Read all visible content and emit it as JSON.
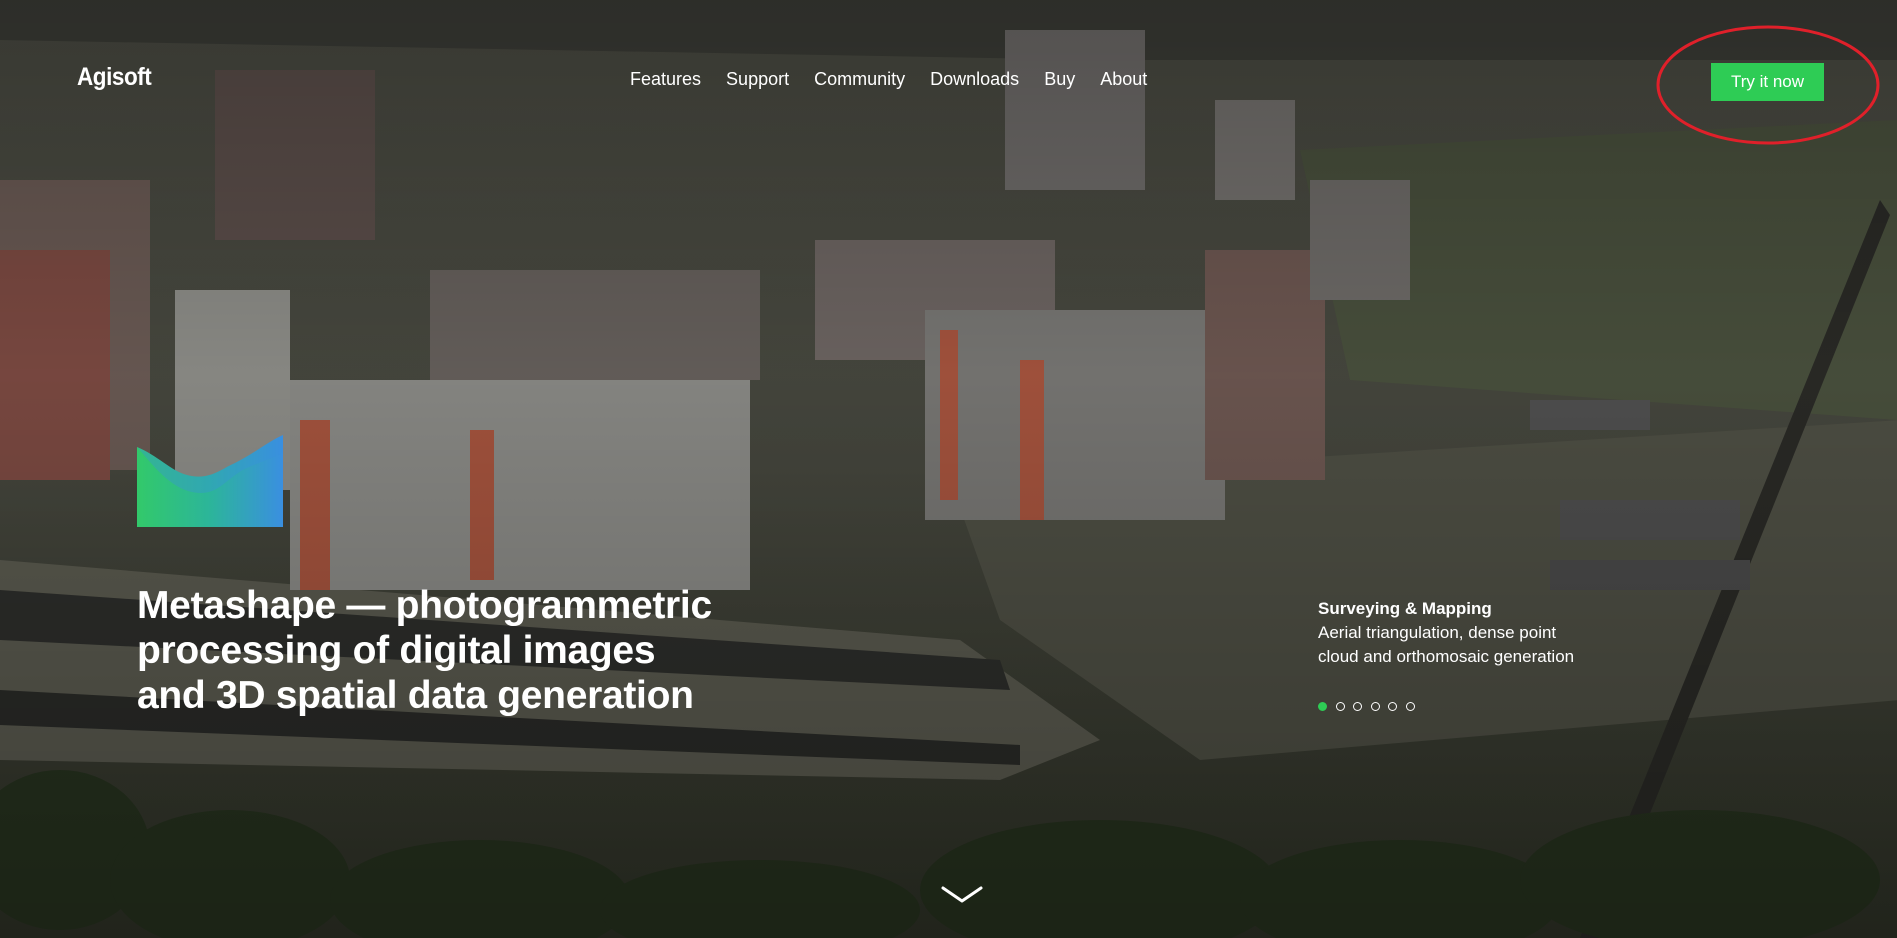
{
  "brand": {
    "logo_text": "Agisoft"
  },
  "nav": {
    "items": [
      {
        "label": "Features"
      },
      {
        "label": "Support"
      },
      {
        "label": "Community"
      },
      {
        "label": "Downloads"
      },
      {
        "label": "Buy"
      },
      {
        "label": "About"
      }
    ]
  },
  "cta": {
    "label": "Try it now",
    "color": "#2ecc55"
  },
  "annotation": {
    "icon": "red-ellipse-highlight",
    "color": "#e0202a"
  },
  "hero": {
    "headline_lines": [
      "Metashape — photogrammetric",
      "processing of digital images",
      "and 3D spatial data generation"
    ],
    "product_icon": "metashape-logo-icon"
  },
  "slider": {
    "title": "Surveying & Mapping",
    "text_lines": [
      "Aerial triangulation, dense point",
      "cloud and orthomosaic generation"
    ],
    "dots": [
      {
        "active": true
      },
      {
        "active": false
      },
      {
        "active": false
      },
      {
        "active": false
      },
      {
        "active": false
      },
      {
        "active": false
      }
    ],
    "active_index": 0,
    "accent": "#2ecc55"
  },
  "scroll": {
    "icon": "chevron-down-icon"
  }
}
